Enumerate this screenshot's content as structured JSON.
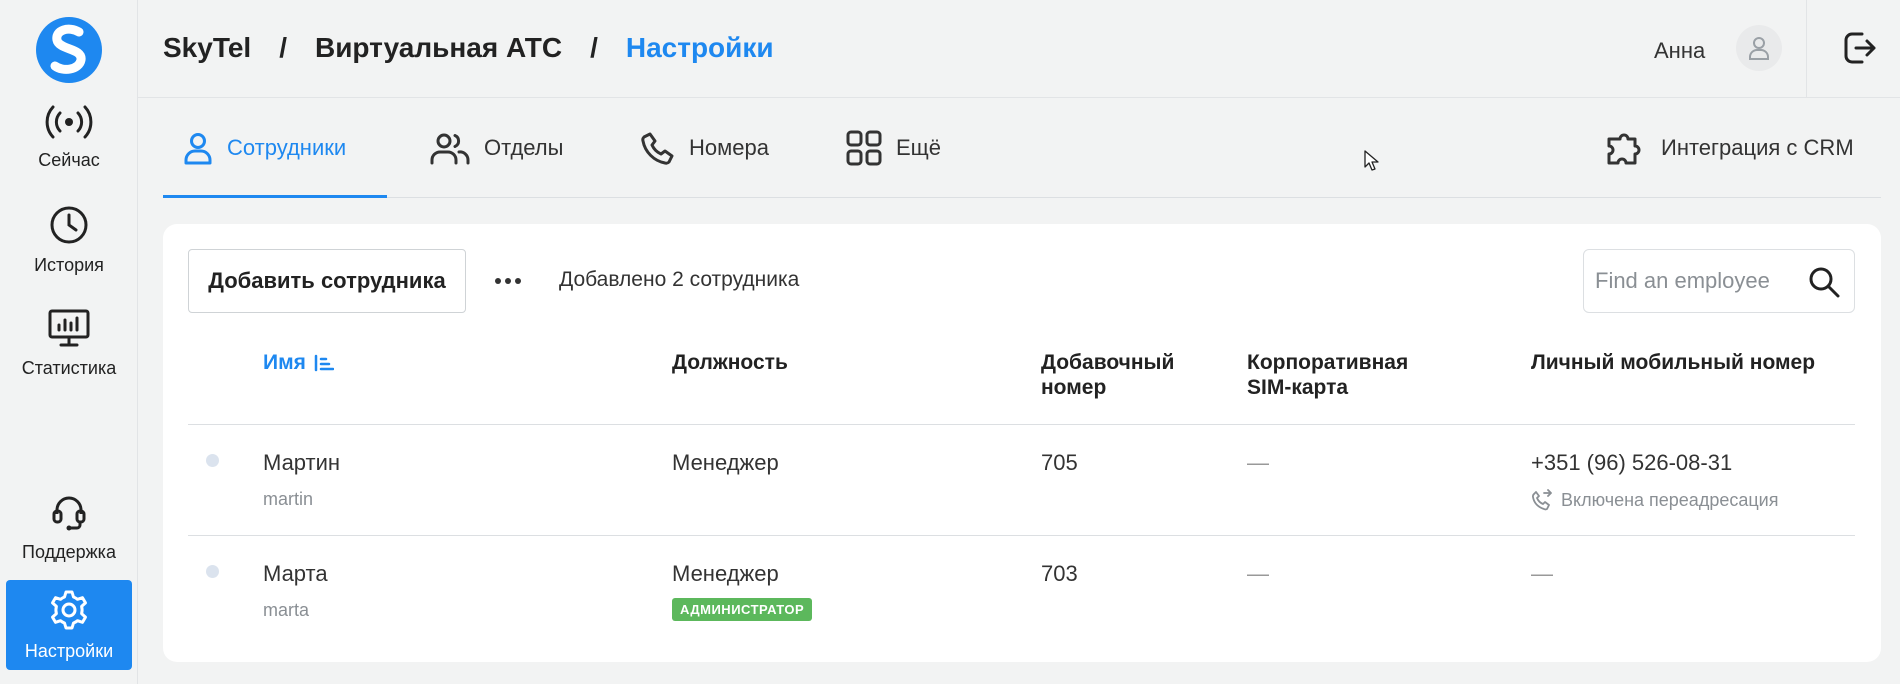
{
  "sidebar": {
    "logo_letter": "S",
    "items": [
      {
        "label": "Сейчас",
        "icon": "broadcast-icon"
      },
      {
        "label": "История",
        "icon": "clock-icon"
      },
      {
        "label": "Статистика",
        "icon": "monitor-chart-icon"
      },
      {
        "label": "Поддержка",
        "icon": "headset-icon"
      },
      {
        "label": "Настройки",
        "icon": "gear-icon",
        "active": true
      }
    ]
  },
  "header": {
    "breadcrumb": [
      "SkyTel",
      "Виртуальная АТС",
      "Настройки"
    ],
    "separator": "/",
    "user_name": "Анна"
  },
  "tabs": [
    {
      "label": "Сотрудники",
      "icon": "user-icon",
      "active": true
    },
    {
      "label": "Отделы",
      "icon": "users-icon"
    },
    {
      "label": "Номера",
      "icon": "phone-icon"
    },
    {
      "label": "Ещё",
      "icon": "grid-icon"
    }
  ],
  "crm_tab": {
    "label": "Интеграция с CRM",
    "icon": "puzzle-icon"
  },
  "toolbar": {
    "add_label": "Добавить сотрудника",
    "added_count": "Добавлено 2 сотрудника",
    "search_placeholder": "Find an employee"
  },
  "table": {
    "columns": {
      "name": "Имя",
      "position": "Должность",
      "extension": "Добавочный номер",
      "corporate_sim": "Корпоративная SIM-карта",
      "personal_mobile": "Личный мобильный номер"
    },
    "rows": [
      {
        "name": "Мартин",
        "login": "martin",
        "position": "Менеджер",
        "extension": "705",
        "corporate_sim": "—",
        "personal_mobile": "+351 (96) 526-08-31",
        "forwarding": "Включена переадресация",
        "badge": ""
      },
      {
        "name": "Марта",
        "login": "marta",
        "position": "Менеджер",
        "extension": "703",
        "corporate_sim": "—",
        "personal_mobile": "—",
        "forwarding": "",
        "badge": "АДМИНИСТРАТОР"
      }
    ]
  },
  "colors": {
    "accent": "#1e88f0",
    "badge": "#5cb85c",
    "background": "#f2f3f3"
  }
}
